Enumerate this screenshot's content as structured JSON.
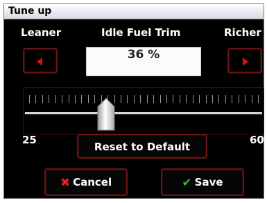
{
  "window": {
    "title": "Tune up"
  },
  "labels": {
    "left": "Leaner",
    "center": "Idle Fuel Trim",
    "right": "Richer"
  },
  "value_display": "36 %",
  "slider": {
    "min_label": "25",
    "max_label": "60",
    "min": 25,
    "max": 60,
    "value": 36,
    "tick_count": 36
  },
  "buttons": {
    "reset": "Reset to Default",
    "cancel": "Cancel",
    "save": "Save"
  },
  "icons": {
    "decrease": "left-arrow-icon",
    "increase": "right-arrow-icon",
    "cancel": "x-icon",
    "save": "checkmark-icon"
  },
  "colors": {
    "arrow": "#e01010",
    "cancel_x": "#e02020",
    "save_check": "#30c030",
    "button_border": "#6a1414"
  }
}
